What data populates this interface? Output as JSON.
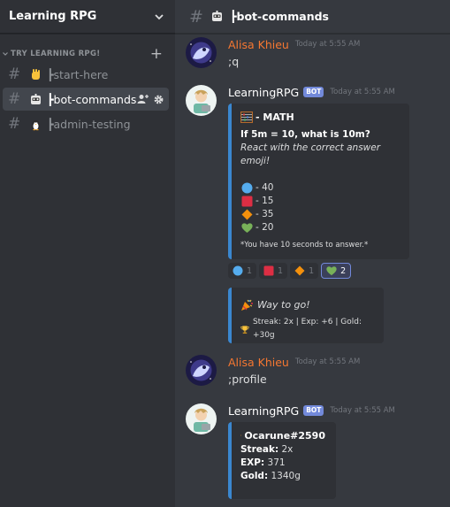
{
  "server": {
    "name": "Learning RPG"
  },
  "category": {
    "label": "TRY LEARNING RPG!"
  },
  "channels": [
    {
      "name": "┣start-here"
    },
    {
      "name": "┣bot-commands"
    },
    {
      "name": "┣admin-testing"
    }
  ],
  "topbar": {
    "channel_name": "┣bot-commands"
  },
  "messages": [
    {
      "author": "Alisa Khieu",
      "time": "Today at 5:55 AM",
      "text": ";q"
    },
    {
      "author": "LearningRPG",
      "bot_tag": "BOT",
      "time": "Today at 5:55 AM",
      "embed": {
        "title": "- MATH",
        "question": "If 5m = 10, what is 10m?",
        "instruction": "React with the correct answer emoji!",
        "options": [
          "- 40",
          "- 15",
          "- 35",
          "- 20"
        ],
        "note": "*You have 10 seconds to answer.*"
      },
      "reactions": [
        {
          "icon": "blue-circle-icon",
          "count": "1"
        },
        {
          "icon": "red-square-icon",
          "count": "1"
        },
        {
          "icon": "orange-diamond-icon",
          "count": "1"
        },
        {
          "icon": "green-heart-icon",
          "count": "2"
        }
      ],
      "result_embed": {
        "title": "Way to go!",
        "stats": "Streak: 2x | Exp: +6 | Gold: +30g"
      }
    },
    {
      "author": "Alisa Khieu",
      "time": "Today at 5:55 AM",
      "text": ";profile"
    },
    {
      "author": "LearningRPG",
      "bot_tag": "BOT",
      "time": "Today at 5:55 AM",
      "profile_embed": {
        "username": "Ocarune#2590",
        "streak_label": "Streak:",
        "streak_value": "2x",
        "exp_label": "EXP:",
        "exp_value": "371",
        "gold_label": "Gold:",
        "gold_value": "1340g"
      }
    }
  ],
  "colors": {
    "accent": "#7289da",
    "embed_border": "#3a87d0",
    "author_orange": "#f57731",
    "bg": "#36393f",
    "sidebar_bg": "#2f3136"
  }
}
